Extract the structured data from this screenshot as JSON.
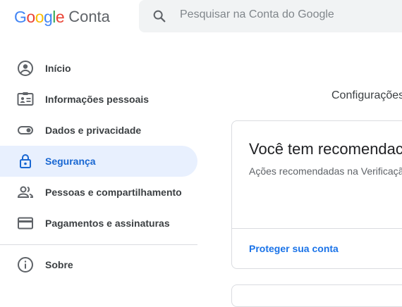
{
  "header": {
    "logo_letters": [
      {
        "ch": "G",
        "color": "#4285F4"
      },
      {
        "ch": "o",
        "color": "#EA4335"
      },
      {
        "ch": "o",
        "color": "#FBBC05"
      },
      {
        "ch": "g",
        "color": "#4285F4"
      },
      {
        "ch": "l",
        "color": "#34A853"
      },
      {
        "ch": "e",
        "color": "#EA4335"
      }
    ],
    "logo_suffix": "Conta",
    "search": {
      "placeholder": "Pesquisar na Conta do Google",
      "icon": "search-icon"
    }
  },
  "sidebar": {
    "items": [
      {
        "label": "Início",
        "icon": "account-circle-icon",
        "active": false
      },
      {
        "label": "Informações pessoais",
        "icon": "id-card-icon",
        "active": false
      },
      {
        "label": "Dados e privacidade",
        "icon": "toggle-icon",
        "active": false
      },
      {
        "label": "Segurança",
        "icon": "lock-icon",
        "active": true
      },
      {
        "label": "Pessoas e compartilhamento",
        "icon": "people-icon",
        "active": false
      },
      {
        "label": "Pagamentos e assinaturas",
        "icon": "credit-card-icon",
        "active": false
      }
    ],
    "footer_items": [
      {
        "label": "Sobre",
        "icon": "info-icon",
        "active": false
      }
    ]
  },
  "main": {
    "section_heading": "Configurações",
    "card": {
      "title": "Você tem recomendac",
      "subtitle": "Ações recomendadas na Verificaçã",
      "link": "Proteger sua conta"
    }
  },
  "colors": {
    "accent": "#1a73e8",
    "active_bg": "#e8f0fe",
    "active_text": "#1967d2"
  }
}
